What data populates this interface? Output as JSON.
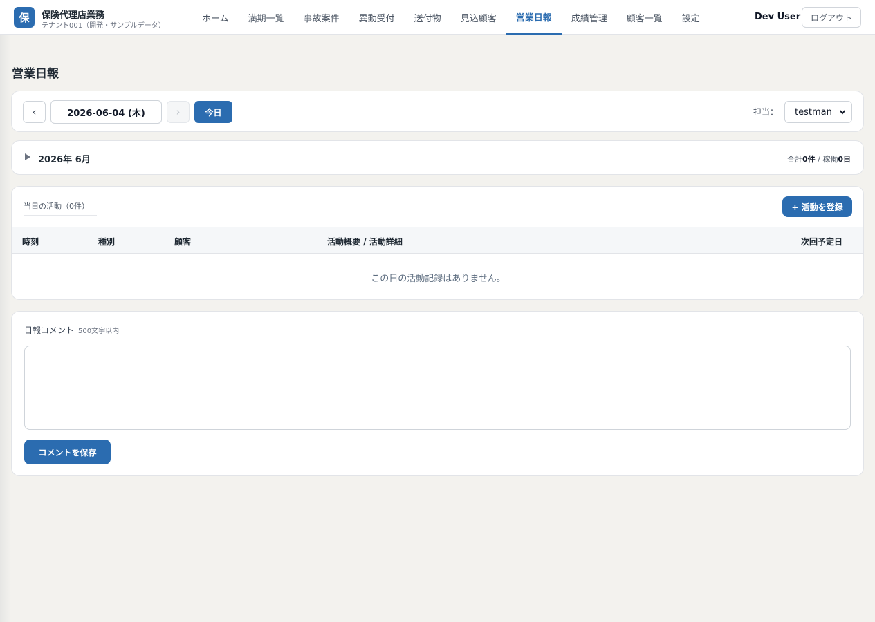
{
  "app": {
    "logo_char": "保",
    "title": "保険代理店業務",
    "subtitle": "テナント001（開発・サンプルデータ）",
    "accent_color": "#2b6cb0"
  },
  "nav": {
    "items": [
      {
        "label": "ホーム",
        "active": false
      },
      {
        "label": "満期一覧",
        "active": false
      },
      {
        "label": "事故案件",
        "active": false
      },
      {
        "label": "異動受付",
        "active": false
      },
      {
        "label": "送付物",
        "active": false
      },
      {
        "label": "見込顧客",
        "active": false
      },
      {
        "label": "営業日報",
        "active": true
      },
      {
        "label": "成績管理",
        "active": false
      },
      {
        "label": "顧客一覧",
        "active": false
      },
      {
        "label": "設定",
        "active": false
      }
    ]
  },
  "user": {
    "name": "Dev User",
    "logout_label": "ログアウト"
  },
  "page": {
    "title": "営業日報"
  },
  "date_bar": {
    "prev_label": "‹",
    "date_value": "2026-06-04 (木)",
    "next_label": "›",
    "today_label": "今日",
    "assignee_label": "担当：",
    "assignee_value": "testman"
  },
  "month_summary": {
    "label": "2026年 6月",
    "total_prefix": "合計",
    "total_value": "0件",
    "separator": " / ",
    "working_prefix": "稼働",
    "working_value": "0日"
  },
  "activity": {
    "title": "当日の活動（0件）",
    "add_button": "+ 活動を登録",
    "columns": [
      "時刻",
      "種別",
      "顧客",
      "活動概要 / 活動詳細",
      "次回予定日"
    ],
    "empty_message": "この日の活動記録はありません。"
  },
  "comment": {
    "label": "日報コメント",
    "hint": "500文字以内",
    "value": "",
    "save_button": "コメントを保存"
  }
}
